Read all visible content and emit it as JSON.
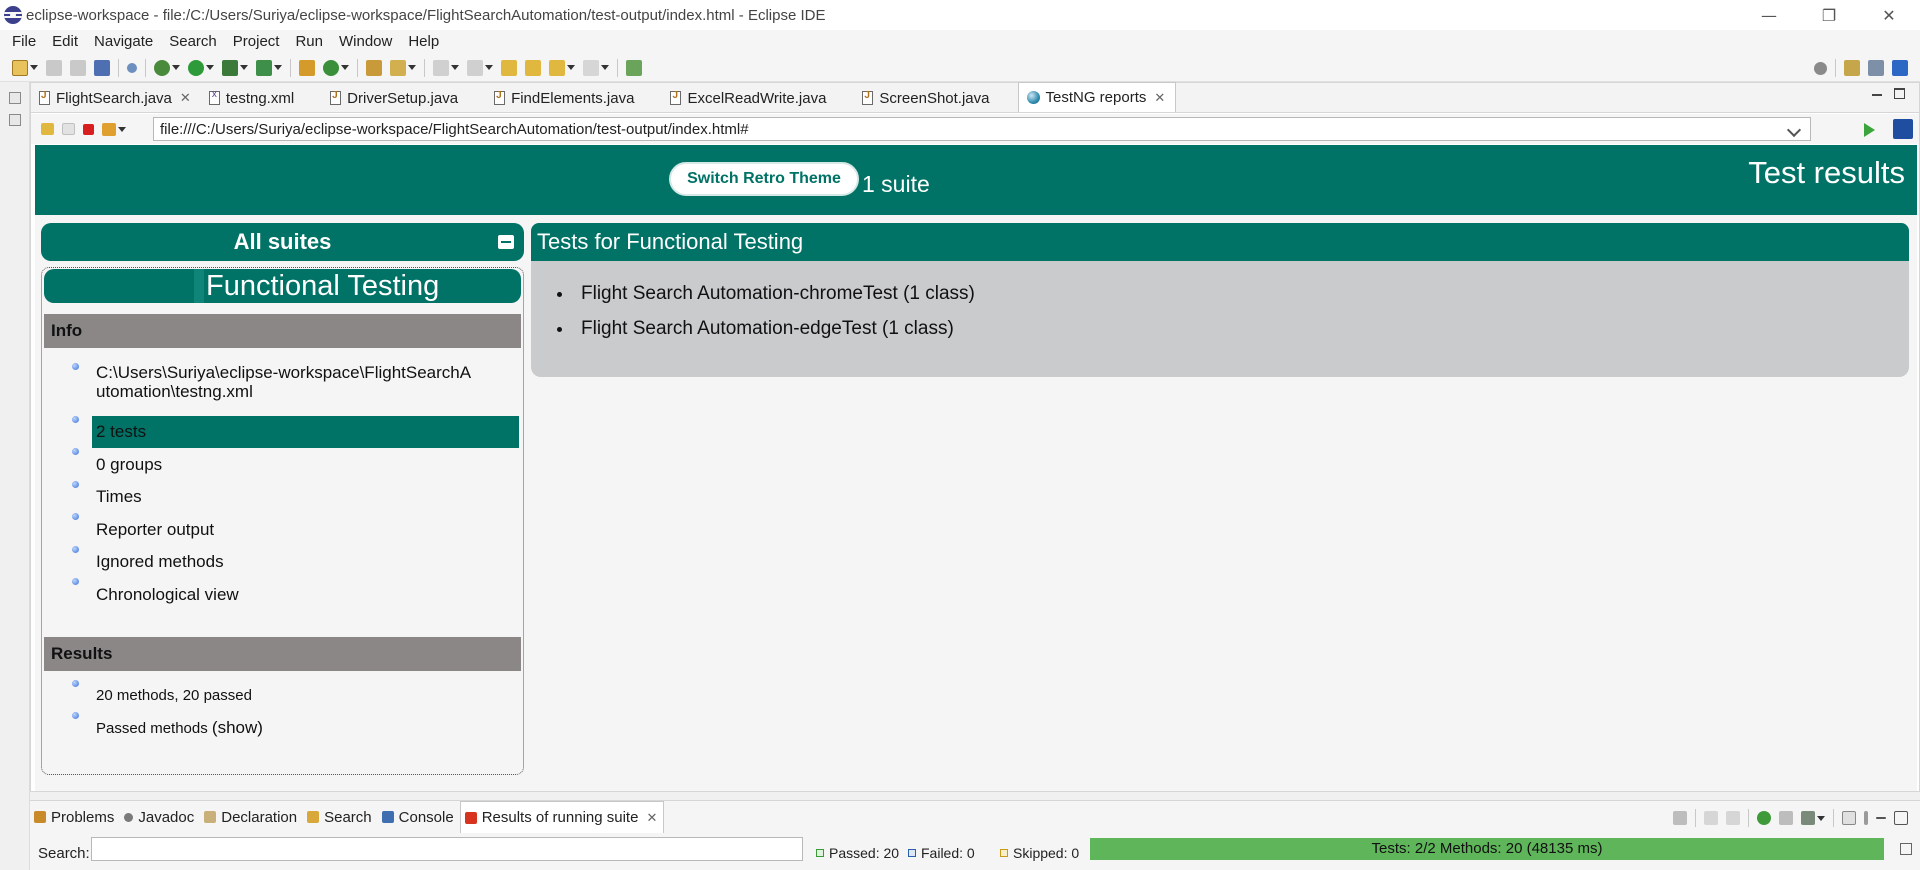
{
  "window": {
    "title": "eclipse-workspace - file:/C:/Users/Suriya/eclipse-workspace/FlightSearchAutomation/test-output/index.html - Eclipse IDE",
    "controls": {
      "minimize": "—",
      "restore": "❐",
      "close": "✕"
    }
  },
  "menu": [
    "File",
    "Edit",
    "Navigate",
    "Search",
    "Project",
    "Run",
    "Window",
    "Help"
  ],
  "editor_tabs": [
    {
      "label": "FlightSearch.java",
      "icon": "java-file-icon",
      "closable": true
    },
    {
      "label": "testng.xml",
      "icon": "xml-file-icon",
      "closable": false
    },
    {
      "label": "DriverSetup.java",
      "icon": "java-file-icon",
      "closable": false
    },
    {
      "label": "FindElements.java",
      "icon": "java-file-icon",
      "closable": false
    },
    {
      "label": "ExcelReadWrite.java",
      "icon": "java-file-icon",
      "closable": false
    },
    {
      "label": "ScreenShot.java",
      "icon": "java-file-icon",
      "closable": false
    },
    {
      "label": "TestNG reports",
      "icon": "globe-icon",
      "closable": true,
      "active": true
    }
  ],
  "browser": {
    "url": "file:///C:/Users/Suriya/eclipse-workspace/FlightSearchAutomation/test-output/index.html#"
  },
  "report": {
    "switch_theme_label": "Switch Retro Theme",
    "suite_count": "1 suite",
    "header_title": "Test results",
    "all_suites_label": "All suites",
    "suite_name": "Functional Testing",
    "info_heading": "Info",
    "info_items": [
      "C:\\Users\\Suriya\\eclipse-workspace\\FlightSearchAutomation\\testng.xml",
      "2 tests",
      "0 groups",
      "Times",
      "Reporter output",
      "Ignored methods",
      "Chronological view"
    ],
    "results_heading": "Results",
    "results_items": [
      "20 methods, 20 passed",
      "Passed methods"
    ],
    "results_show_link": "(show)",
    "tests_heading": "Tests for Functional Testing",
    "tests": [
      "Flight Search Automation-chromeTest (1 class)",
      "Flight Search Automation-edgeTest (1 class)"
    ],
    "accent_color": "#007266"
  },
  "bottom_views": [
    {
      "label": "Problems",
      "icon": "problems-icon"
    },
    {
      "label": "Javadoc",
      "icon": "javadoc-icon"
    },
    {
      "label": "Declaration",
      "icon": "declaration-icon"
    },
    {
      "label": "Search",
      "icon": "search-icon"
    },
    {
      "label": "Console",
      "icon": "console-icon"
    },
    {
      "label": "Results of running suite",
      "icon": "testng-icon",
      "active": true,
      "closable": true
    }
  ],
  "results_view": {
    "search_label": "Search:",
    "search_value": "",
    "passed": "Passed: 20",
    "failed": "Failed: 0",
    "skipped": "Skipped: 0",
    "progress_text": "Tests: 2/2  Methods: 20 (48135 ms)",
    "progress_fraction": 1.0,
    "progress_color": "#5fb55a"
  }
}
